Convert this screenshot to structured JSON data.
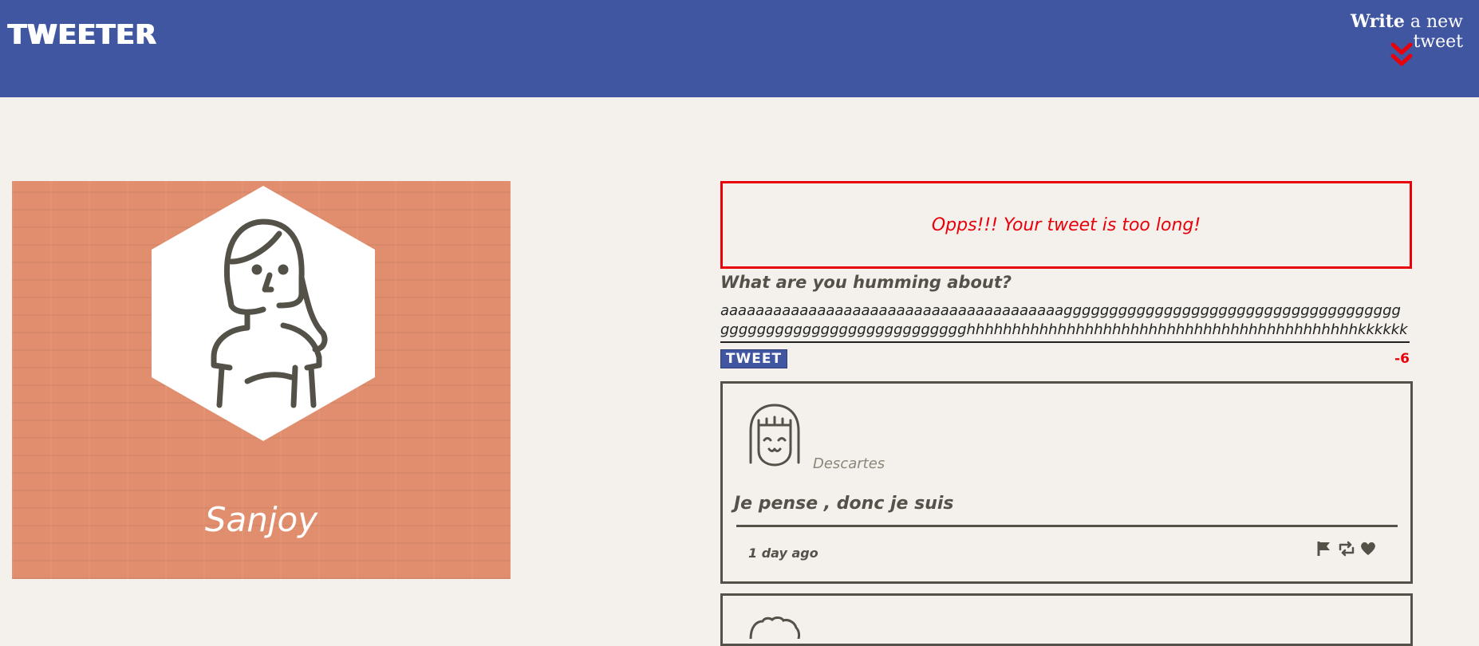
{
  "nav": {
    "brand": "TWEETER",
    "compose_bold": "Write",
    "compose_rest": " a new tweet",
    "chevron_icon": "double-chevron-down-icon",
    "chevron_color": "#e8000b",
    "background": "#4056a1"
  },
  "profile": {
    "name": "Sanjoy",
    "avatar_icon": "person-long-hair-icon",
    "background": "#e08e6d"
  },
  "composer": {
    "error": "Opps!!! Your tweet is too long!",
    "label": "What are you humming about?",
    "text": "aaaaaaaaaaaaaaaaaaaaaaaaaaaaaaaaaaaaaaagggggggggggggggggggggggggggggggggggggggggggggggggggggggggggggggghhhhhhhhhhhhhhhhhhhhhhhhhhhhhhhhhhhhhhhhhhhkkkkkk",
    "button": "TWEET",
    "counter": "-6"
  },
  "tweets": [
    {
      "handle": "Descartes",
      "body": "Je pense , donc je suis",
      "time": "1 day ago",
      "avatar_icon": "smiling-girl-avatar-icon",
      "actions": [
        "flag-icon",
        "retweet-icon",
        "heart-icon"
      ]
    }
  ]
}
